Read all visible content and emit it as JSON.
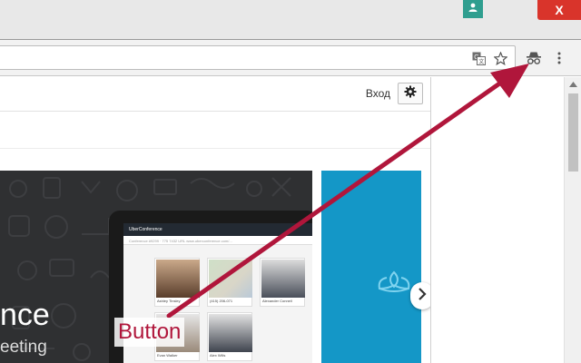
{
  "window": {
    "close_label": "X",
    "icons": {
      "profile": "person-icon",
      "close": "close-icon"
    }
  },
  "toolbar": {
    "icons": [
      "translate-icon",
      "star-icon",
      "incognito-icon",
      "more-vert-icon"
    ]
  },
  "site": {
    "login_label": "Вход",
    "settings_icon": "gear-icon"
  },
  "hero": {
    "title_fragment": "nce",
    "subtitle_fragment": "eeting",
    "app": {
      "brand": "UberConference",
      "subheader": "Conference #9299 · 775 7432 URL www.uberconference.com/...",
      "participants": [
        {
          "name": "Ashley Tinsley",
          "detail": ""
        },
        {
          "name": "(415) 206-071",
          "detail": ""
        },
        {
          "name": "Alexander Connell",
          "detail": ""
        },
        {
          "name": "Evan Walker",
          "detail": ""
        },
        {
          "name": "Alex Wills",
          "detail": ""
        }
      ]
    }
  },
  "promo": {
    "icon": "lotus-icon",
    "next_icon": "chevron-right-icon"
  },
  "annotation": {
    "label": "Button",
    "color": "#b0163b"
  },
  "colors": {
    "close": "#d9342b",
    "profile": "#2f9e8f",
    "hero_bg": "#2f3032",
    "promo_bg": "#1497c7"
  }
}
